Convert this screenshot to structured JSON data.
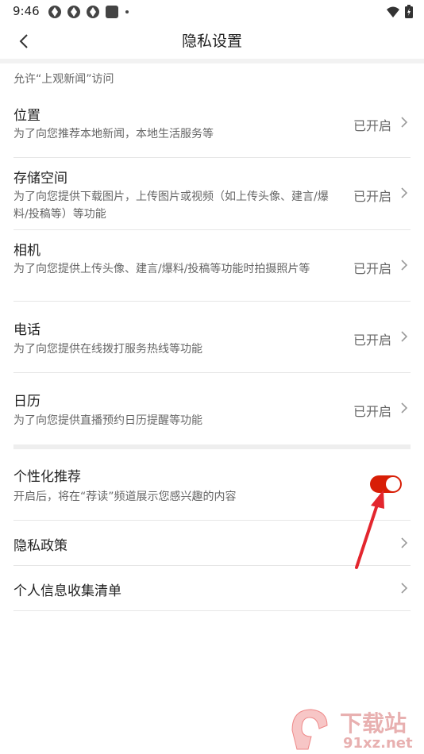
{
  "status_bar": {
    "time": "9:46"
  },
  "header": {
    "title": "隐私设置"
  },
  "section_caption": "允许“上观新闻”访问",
  "permissions": [
    {
      "title": "位置",
      "desc": "为了向您推荐本地新闻，本地生活服务等",
      "status": "已开启"
    },
    {
      "title": "存储空间",
      "desc": "为了向您提供下载图片，上传图片或视频（如上传头像、建言/爆料/投稿等）等功能",
      "status": "已开启"
    },
    {
      "title": "相机",
      "desc": "为了向您提供上传头像、建言/爆料/投稿等功能时拍摄照片等",
      "status": "已开启"
    },
    {
      "title": "电话",
      "desc": "为了向您提供在线拨打服务热线等功能",
      "status": "已开启"
    },
    {
      "title": "日历",
      "desc": "为了向您提供直播预约日历提醒等功能",
      "status": "已开启"
    }
  ],
  "personalization": {
    "title": "个性化推荐",
    "desc": "开启后，将在“荐读”频道展示您感兴趣的内容",
    "enabled": true
  },
  "links": [
    {
      "label": "隐私政策"
    },
    {
      "label": "个人信息收集清单"
    }
  ],
  "watermark": {
    "text": "下载站",
    "site": "91xz.net"
  },
  "colors": {
    "accent": "#d81e06",
    "annotation": "#e3262e"
  }
}
